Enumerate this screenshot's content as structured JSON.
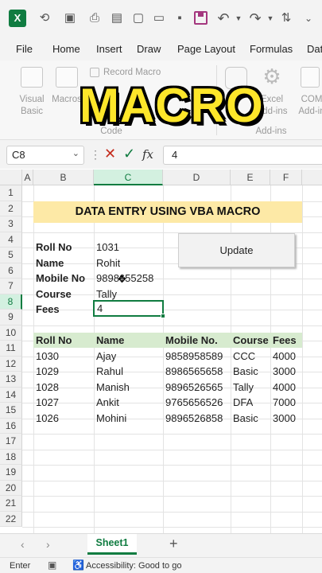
{
  "menu": [
    "File",
    "Home",
    "Insert",
    "Draw",
    "Page Layout",
    "Formulas",
    "Dat"
  ],
  "ribbon": {
    "visual_basic": "Visual\nBasic",
    "macros": "Macros",
    "record_macro": "Record Macro",
    "code_group": "Code",
    "excel_addins": "Excel\nAdd-ins",
    "com_addins": "COM\nAdd-in",
    "addins_group": "Add-ins"
  },
  "overlay_title": "MACRO",
  "formula_bar": {
    "name_box": "C8",
    "fx": "fx",
    "value": "4"
  },
  "columns": [
    "A",
    "B",
    "C",
    "D",
    "E",
    "F"
  ],
  "rows": [
    "1",
    "2",
    "3",
    "4",
    "5",
    "6",
    "7",
    "8",
    "9",
    "10",
    "11",
    "12",
    "13",
    "14",
    "15",
    "16",
    "17",
    "18",
    "19",
    "20",
    "21",
    "22"
  ],
  "sheet_title": "DATA ENTRY USING VBA MACRO",
  "form": {
    "labels": [
      "Roll No",
      "Name",
      "Mobile No",
      "Course",
      "Fees"
    ],
    "values": [
      "1031",
      "Rohit",
      "9898655258",
      "Tally",
      "4"
    ]
  },
  "update_button": "Update",
  "table": {
    "headers": [
      "Roll No",
      "Name",
      "Mobile No.",
      "Course",
      "Fees"
    ],
    "rows": [
      [
        "1030",
        "Ajay",
        "9858958589",
        "CCC",
        "4000"
      ],
      [
        "1029",
        "Rahul",
        "8986565658",
        "Basic",
        "3000"
      ],
      [
        "1028",
        "Manish",
        "9896526565",
        "Tally",
        "4000"
      ],
      [
        "1027",
        "Ankit",
        "9765656526",
        "DFA",
        "7000"
      ],
      [
        "1026",
        "Mohini",
        "9896526858",
        "Basic",
        "3000"
      ]
    ]
  },
  "sheet_tab": "Sheet1",
  "status": {
    "mode": "Enter",
    "accessibility": "Accessibility: Good to go"
  },
  "colors": {
    "accent_green": "#107c41",
    "title_fill": "#fde9a6",
    "header_fill": "#d7ebcf",
    "overlay_yellow": "#fde62a"
  }
}
